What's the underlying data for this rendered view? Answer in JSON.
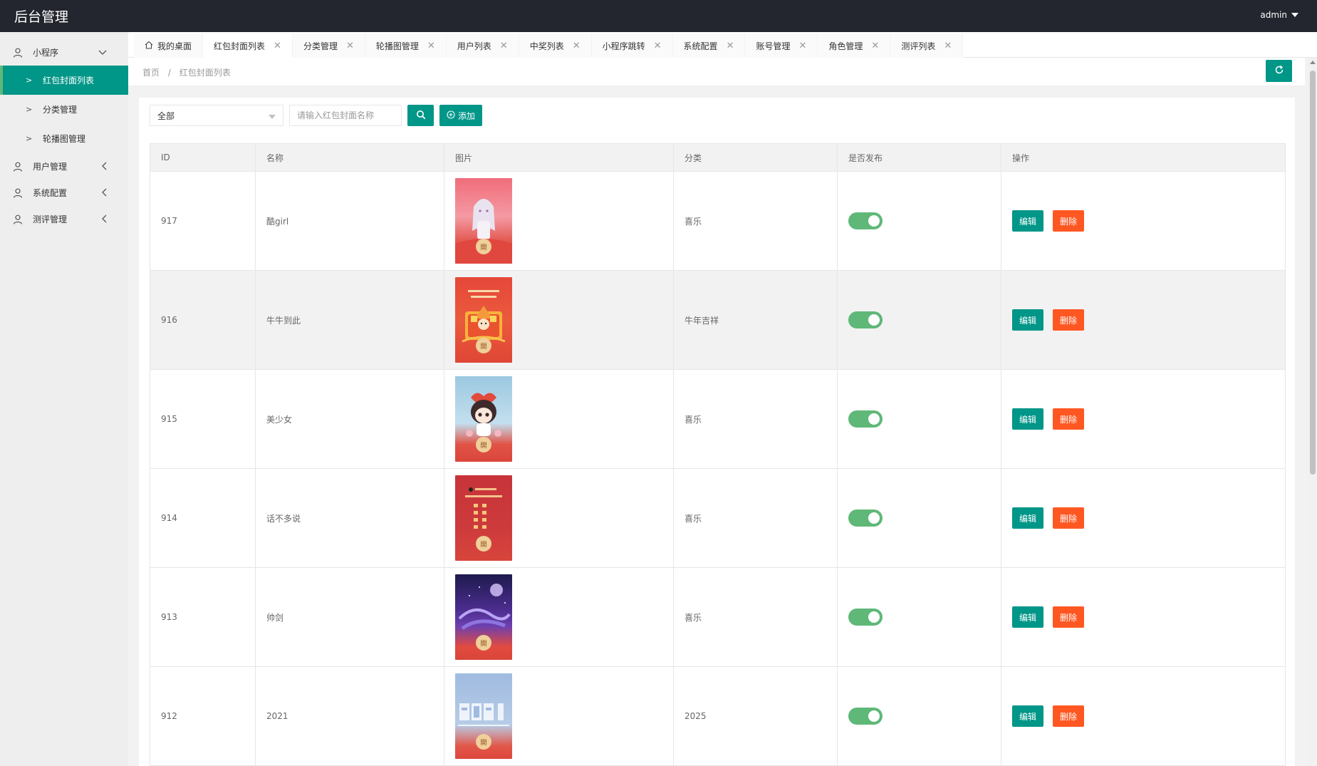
{
  "header": {
    "brand": "后台管理",
    "user": "admin"
  },
  "sidebar": {
    "groups": [
      {
        "label": "小程序",
        "icon": "user-icon",
        "expanded": true,
        "items": [
          {
            "label": "红包封面列表",
            "active": true
          },
          {
            "label": "分类管理",
            "active": false
          },
          {
            "label": "轮播图管理",
            "active": false
          }
        ]
      },
      {
        "label": "用户管理",
        "icon": "user-icon",
        "expanded": false
      },
      {
        "label": "系统配置",
        "icon": "user-icon",
        "expanded": false
      },
      {
        "label": "测评管理",
        "icon": "user-icon",
        "expanded": false
      }
    ]
  },
  "tabs": [
    {
      "label": "我的桌面",
      "icon": "home-icon",
      "closable": false
    },
    {
      "label": "红包封面列表",
      "closable": true,
      "active": true
    },
    {
      "label": "分类管理",
      "closable": true
    },
    {
      "label": "轮播图管理",
      "closable": true
    },
    {
      "label": "用户列表",
      "closable": true
    },
    {
      "label": "中奖列表",
      "closable": true
    },
    {
      "label": "小程序跳转",
      "closable": true
    },
    {
      "label": "系统配置",
      "closable": true
    },
    {
      "label": "账号管理",
      "closable": true
    },
    {
      "label": "角色管理",
      "closable": true
    },
    {
      "label": "测评列表",
      "closable": true
    }
  ],
  "breadcrumb": {
    "home": "首页",
    "sep": "/",
    "current": "红包封面列表"
  },
  "filters": {
    "category_selected": "全部",
    "search_placeholder": "请输入红包封面名称",
    "add_label": "添加"
  },
  "table": {
    "columns": [
      "ID",
      "名称",
      "图片",
      "分类",
      "是否发布",
      "操作"
    ],
    "edit_label": "编辑",
    "delete_label": "删除",
    "open_glyph": "開",
    "rows": [
      {
        "id": "917",
        "name": "酷girl",
        "category": "喜乐",
        "published": true,
        "thumb": "anime-girl"
      },
      {
        "id": "916",
        "name": "牛牛到此",
        "category": "牛年吉祥",
        "published": true,
        "thumb": "ox-new-year"
      },
      {
        "id": "915",
        "name": "美少女",
        "category": "喜乐",
        "published": true,
        "thumb": "chibi-girl"
      },
      {
        "id": "914",
        "name": "话不多说",
        "category": "喜乐",
        "published": true,
        "thumb": "calligraphy"
      },
      {
        "id": "913",
        "name": "帅剑",
        "category": "喜乐",
        "published": true,
        "thumb": "purple-night"
      },
      {
        "id": "912",
        "name": "2021",
        "category": "2025",
        "published": true,
        "thumb": "year-2021"
      }
    ]
  },
  "colors": {
    "primary": "#009688",
    "danger": "#ff5722",
    "switch_on": "#5fb878",
    "header_bg": "#23262e"
  }
}
